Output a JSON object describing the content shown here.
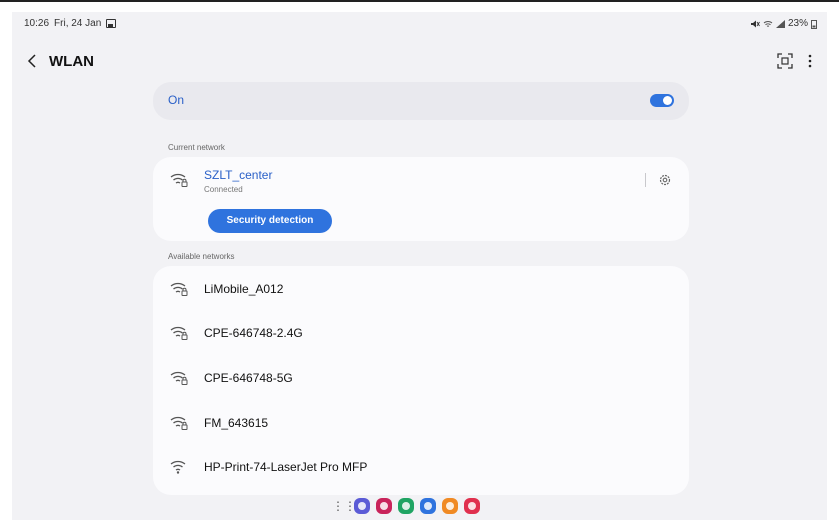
{
  "status_bar": {
    "time": "10:26",
    "date": "Fri, 24 Jan",
    "battery": "23%",
    "icons": [
      "gallery-icon",
      "mute-icon",
      "wifi-icon",
      "signal-icon",
      "battery-icon"
    ]
  },
  "header": {
    "title": "WLAN",
    "back_icon": "chevron-left-icon",
    "scan_icon": "qr-scan-icon",
    "more_icon": "more-vert-icon"
  },
  "wlan_toggle": {
    "label": "On",
    "enabled": true
  },
  "current_network": {
    "section_label": "Current network",
    "name": "SZLT_center",
    "status": "Connected",
    "security_button": "Security detection"
  },
  "available_networks": {
    "section_label": "Available networks",
    "items": [
      {
        "name": "LiMobile_A012",
        "secured": true
      },
      {
        "name": "CPE-646748-2.4G",
        "secured": true
      },
      {
        "name": "CPE-646748-5G",
        "secured": true
      },
      {
        "name": "FM_643615",
        "secured": true
      },
      {
        "name": "HP-Print-74-LaserJet Pro MFP",
        "secured": false
      }
    ]
  },
  "dock": {
    "apps": [
      {
        "icon": "apps-grid-icon"
      },
      {
        "icon": "internet-icon",
        "color": "#5b5bd6"
      },
      {
        "icon": "flower-icon",
        "color": "#c9245b"
      },
      {
        "icon": "phone-icon",
        "color": "#1fa463"
      },
      {
        "icon": "messages-icon",
        "color": "#2f73de"
      },
      {
        "icon": "contacts-icon",
        "color": "#f08a24"
      },
      {
        "icon": "camera-icon",
        "color": "#e0304e"
      }
    ]
  },
  "colors": {
    "accent": "#2f73de",
    "link": "#2a60c8",
    "background": "#f2f2f5"
  }
}
